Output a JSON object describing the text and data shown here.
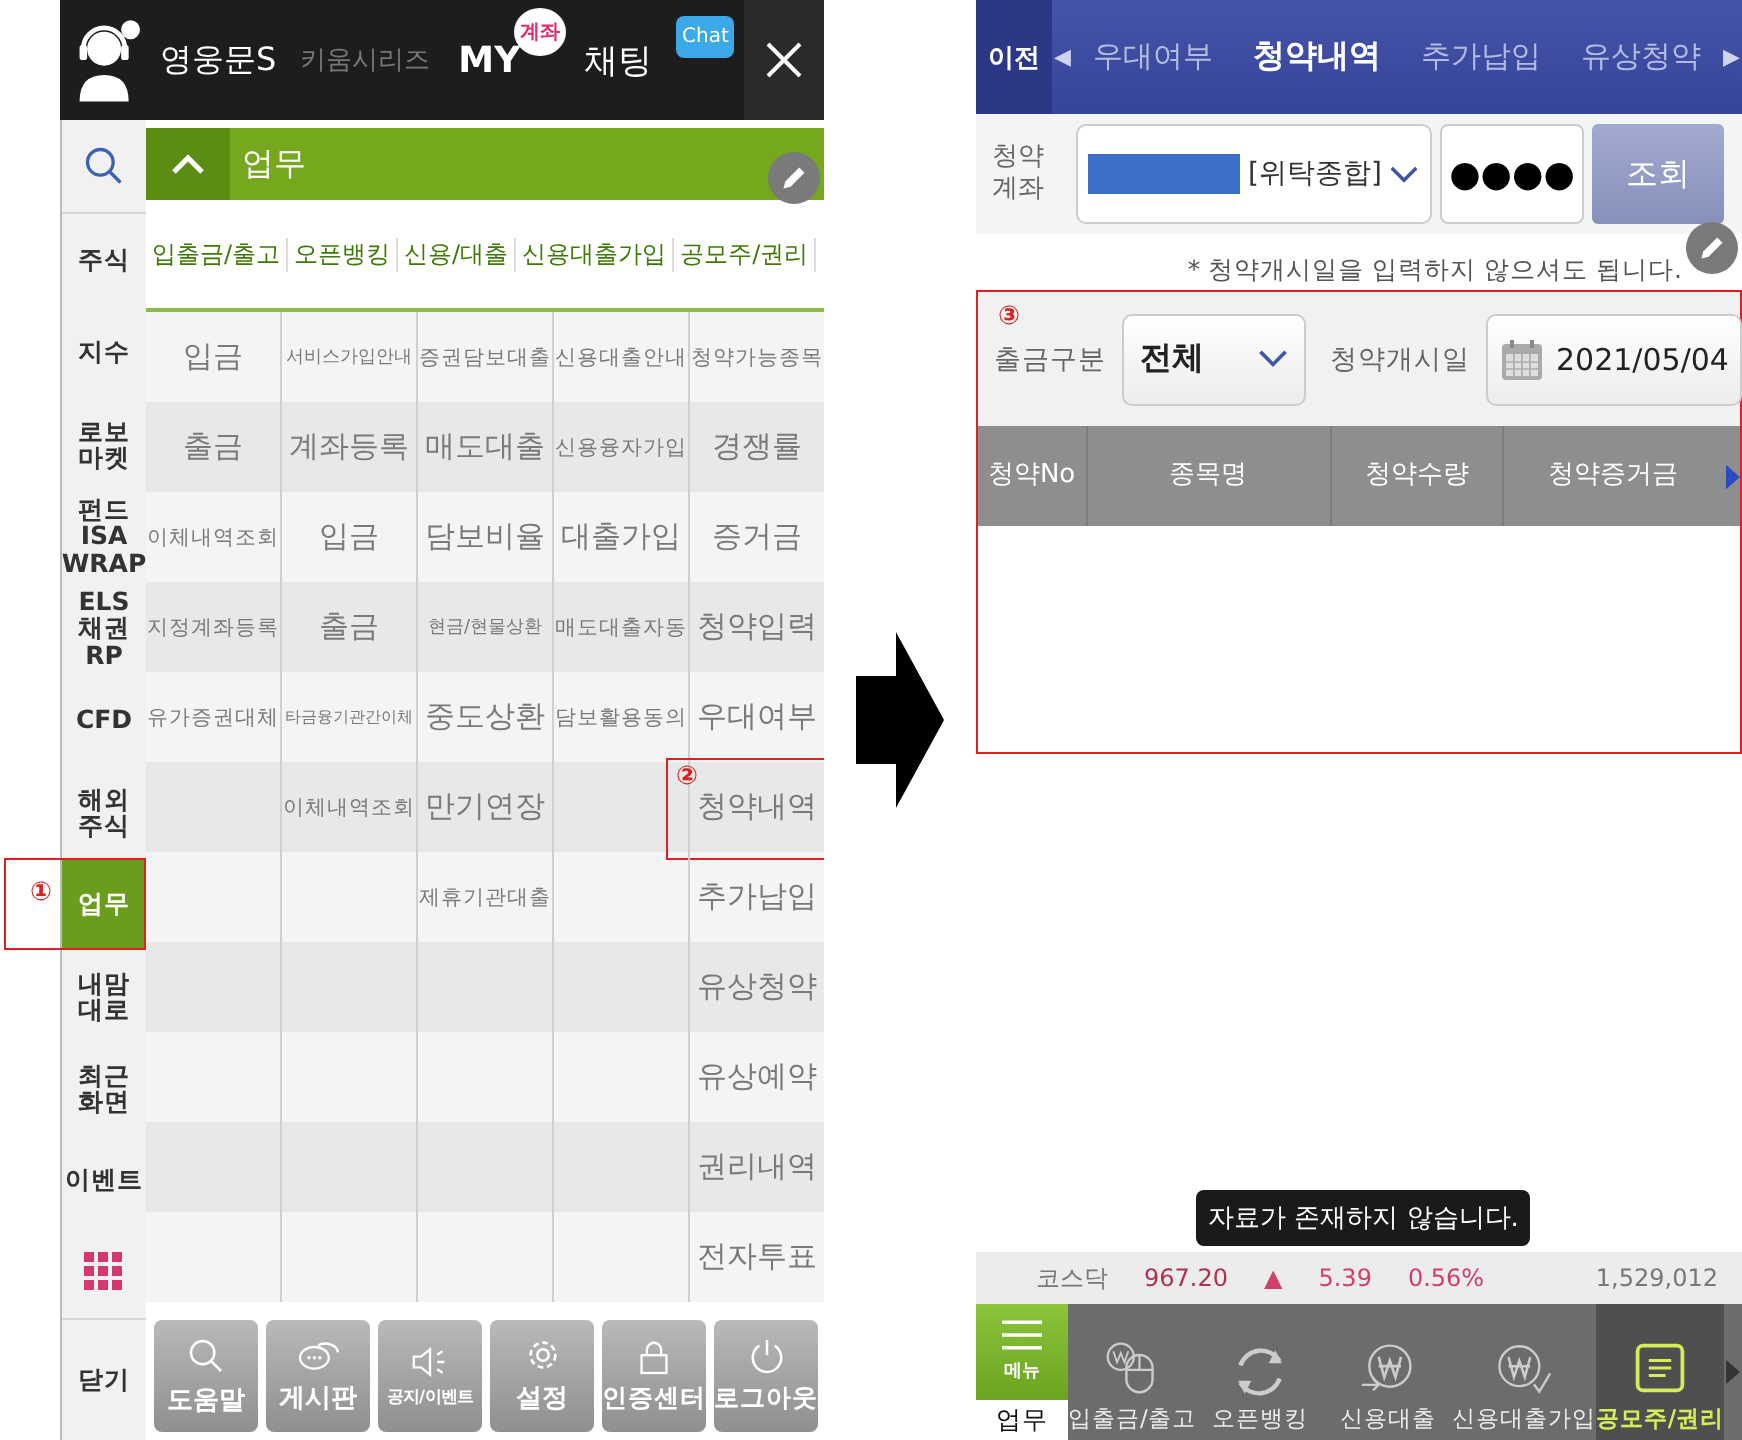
{
  "left_screen": {
    "header": {
      "app_name": "영웅문S",
      "series": "키움시리즈",
      "my": "MY",
      "my_badge": "계좌",
      "chat": "채팅",
      "chat_badge": "Chat"
    },
    "sidebar": {
      "items": [
        {
          "kind": "search",
          "selected": false
        },
        {
          "kind": "text",
          "label": "주식",
          "selected": false
        },
        {
          "kind": "text",
          "label": "지수",
          "selected": false
        },
        {
          "kind": "text",
          "label": "로보\n마켓",
          "selected": false
        },
        {
          "kind": "text",
          "label": "펀드\nISA\nWRAP",
          "selected": false
        },
        {
          "kind": "text",
          "label": "ELS\n채권\nRP",
          "selected": false
        },
        {
          "kind": "text",
          "label": "CFD",
          "selected": false
        },
        {
          "kind": "text",
          "label": "해외\n주식",
          "selected": false
        },
        {
          "kind": "text",
          "label": "업무",
          "selected": true,
          "annotation": "①"
        },
        {
          "kind": "text",
          "label": "내맘\n대로",
          "selected": false
        },
        {
          "kind": "text",
          "label": "최근\n화면",
          "selected": false
        },
        {
          "kind": "text",
          "label": "이벤트",
          "selected": false
        },
        {
          "kind": "apps",
          "selected": false
        }
      ],
      "close": "닫기"
    },
    "section": {
      "title": "업무",
      "expanded": true
    },
    "tabs": [
      "입출금/출고",
      "오픈뱅킹",
      "신용/대출",
      "신용대출가입",
      "공모주/권리"
    ],
    "menu_grid": {
      "columns": [
        [
          {
            "text": "입금"
          },
          {
            "text": "출금"
          },
          {
            "text": "이체내역조회"
          },
          {
            "text": "지정계좌등록"
          },
          {
            "text": "유가증권대체"
          }
        ],
        [
          {
            "text": "서비스가입안내"
          },
          {
            "text": "계좌등록"
          },
          {
            "text": "입금"
          },
          {
            "text": "출금"
          },
          {
            "text": "타금융기관간이체"
          },
          {
            "text": "이체내역조회"
          }
        ],
        [
          {
            "text": "증권담보대출"
          },
          {
            "text": "매도대출"
          },
          {
            "text": "담보비율"
          },
          {
            "text": "현금/현물상환"
          },
          {
            "text": "중도상환"
          },
          {
            "text": "만기연장"
          },
          {
            "text": "제휴기관대출"
          }
        ],
        [
          {
            "text": "신용대출안내"
          },
          {
            "text": "신용융자가입"
          },
          {
            "text": "대출가입"
          },
          {
            "text": "매도대출자동"
          },
          {
            "text": "담보활용동의"
          }
        ],
        [
          {
            "text": "청약가능종목"
          },
          {
            "text": "경쟁률"
          },
          {
            "text": "증거금"
          },
          {
            "text": "청약입력"
          },
          {
            "text": "우대여부"
          },
          {
            "text": "청약내역",
            "annotation": "②"
          },
          {
            "text": "추가납입"
          },
          {
            "text": "유상청약"
          },
          {
            "text": "유상예약"
          },
          {
            "text": "권리내역"
          },
          {
            "text": "전자투표"
          }
        ]
      ]
    },
    "toolbar": [
      {
        "label": "도움말"
      },
      {
        "label": "게시판"
      },
      {
        "label": "공지/이벤트"
      },
      {
        "label": "설정"
      },
      {
        "label": "인증센터"
      },
      {
        "label": "로그아웃"
      }
    ]
  },
  "right_screen": {
    "nav": {
      "back": "이전",
      "prev_arrow": "◀",
      "next_arrow": "▶",
      "items": [
        {
          "label": "우대여부",
          "selected": false
        },
        {
          "label": "청약내역",
          "selected": true
        },
        {
          "label": "추가납입",
          "selected": false
        },
        {
          "label": "유상청약",
          "selected": false
        }
      ]
    },
    "account": {
      "label": "청약\n계좌",
      "account_type": "[위탁종합]",
      "password": "●●●●",
      "query_button": "조회"
    },
    "note": "* 청약개시일을 입력하지 않으셔도 됩니다.",
    "filter": {
      "annotation": "③",
      "type_label": "출금구분",
      "type_value": "전체",
      "date_label": "청약개시일",
      "date_value": "2021/05/04"
    },
    "table": {
      "columns": [
        "청약No",
        "종목명",
        "청약수량",
        "청약증거금"
      ]
    },
    "ticker": {
      "index": "코스닥",
      "value": "967.20",
      "direction": "▲",
      "change": "5.39",
      "rate": "0.56%",
      "volume": "1,529,012"
    },
    "toast": "자료가 존재하지 않습니다.",
    "bottom_nav": {
      "menu": "메뉴",
      "menu_caption": "업무",
      "items": [
        {
          "label": "입출금/출고",
          "selected": false
        },
        {
          "label": "오픈뱅킹",
          "selected": false
        },
        {
          "label": "신용대출",
          "selected": false
        },
        {
          "label": "신용대출가입",
          "selected": false
        },
        {
          "label": "공모주/권리",
          "selected": true
        }
      ]
    }
  }
}
